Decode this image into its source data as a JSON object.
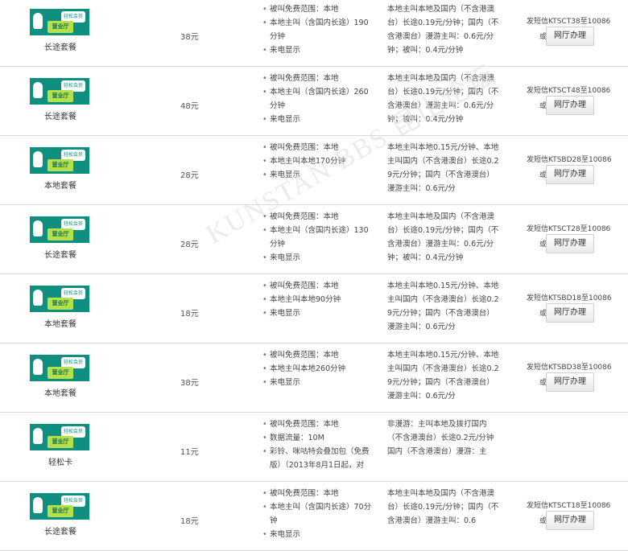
{
  "card": {
    "bubble": "轻松会员",
    "logo": "营业厅"
  },
  "rows": [
    {
      "name": "长途套餐",
      "price": "38元",
      "features": [
        "被叫免费范围：本地",
        "本地主叫（含国内长途）190分钟",
        "来电显示"
      ],
      "rates": "本地主叫本地及国内（不含港澳台）长途0.19元/分钟；国内（不含港澳台）漫游主叫：0.6元/分钟；被叫：0.4元/分钟",
      "sms": "发短信KTSCT38至10086",
      "or": "或",
      "button": "网厅办理"
    },
    {
      "name": "长途套餐",
      "price": "48元",
      "features": [
        "被叫免费范围：本地",
        "本地主叫（含国内长途）260分钟",
        "来电显示"
      ],
      "rates": "本地主叫本地及国内（不含港澳台）长途0.19元/分钟；国内（不含港澳台）漫游主叫：0.6元/分钟；被叫：0.4元/分钟",
      "sms": "发短信KTSCT48至10086",
      "or": "或",
      "button": "网厅办理"
    },
    {
      "name": "本地套餐",
      "price": "28元",
      "features": [
        "被叫免费范围：本地",
        "本地主叫本地170分钟",
        "来电显示"
      ],
      "rates": "本地主叫本地0.15元/分钟、本地主叫国内（不含港澳台）长途0.29元/分钟；国内（不含港澳台）漫游主叫：0.6元/分",
      "sms": "发短信KTSBD28至10086",
      "or": "或",
      "button": "网厅办理"
    },
    {
      "name": "长途套餐",
      "price": "28元",
      "features": [
        "被叫免费范围：本地",
        "本地主叫（含国内长途）130分钟",
        "来电显示"
      ],
      "rates": "本地主叫本地及国内（不含港澳台）长途0.19元/分钟；国内（不含港澳台）漫游主叫：0.6元/分钟；被叫：0.4元/分钟",
      "sms": "发短信KTSCT28至10086",
      "or": "或",
      "button": "网厅办理"
    },
    {
      "name": "本地套餐",
      "price": "18元",
      "features": [
        "被叫免费范围：本地",
        "本地主叫本地90分钟",
        "来电显示"
      ],
      "rates": "本地主叫本地0.15元/分钟、本地主叫国内（不含港澳台）长途0.29元/分钟；国内（不含港澳台）漫游主叫：0.6元/分",
      "sms": "发短信KTSBD18至10086",
      "or": "或",
      "button": "网厅办理"
    },
    {
      "name": "本地套餐",
      "price": "38元",
      "features": [
        "被叫免费范围：本地",
        "本地主叫本地260分钟",
        "来电显示"
      ],
      "rates": "本地主叫本地0.15元/分钟、本地主叫国内（不含港澳台）长途0.29元/分钟；国内（不含港澳台）漫游主叫：0.6元/分",
      "sms": "发短信KTSBD38至10086",
      "or": "或",
      "button": "网厅办理"
    },
    {
      "name": "轻松卡",
      "price": "11元",
      "features": [
        "被叫免费范围：本地",
        "数据流量：10M",
        "彩铃、咪咕特会叠加包（免费版）（2013年8月1日起，对"
      ],
      "rates": "非漫游：主叫本地及拨打国内（不含港澳台）长途0.2元/分钟国内（不含港澳台）漫游：主",
      "sms": "",
      "or": "",
      "button": ""
    },
    {
      "name": "长途套餐",
      "price": "18元",
      "features": [
        "被叫免费范围：本地",
        "本地主叫（含国内长途）70分钟",
        "来电显示"
      ],
      "rates": "本地主叫本地及国内（不含港澳台）长途0.19元/分钟；国内（不含港澳台）漫游主叫：0.6",
      "sms": "发短信KTSCT18至10086",
      "or": "或",
      "button": "网厅办理"
    }
  ],
  "watermark": "KUNSTAN BBS 昆山论坛"
}
